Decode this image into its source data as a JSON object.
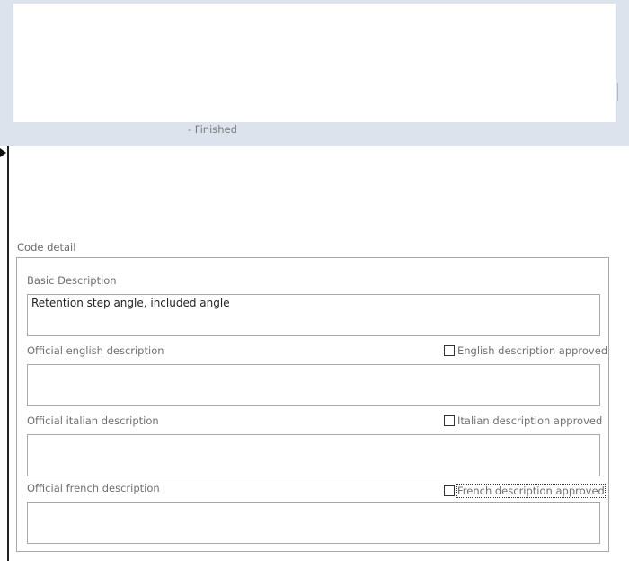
{
  "header": {
    "status_text": "- Finished"
  },
  "code_detail": {
    "group_label": "Code detail",
    "basic": {
      "label": "Basic Description",
      "value": "Retention step angle, included angle"
    },
    "english": {
      "label": "Official english description",
      "value": "",
      "approved_label": "English description approved",
      "approved": false
    },
    "italian": {
      "label": "Official italian description",
      "value": "",
      "approved_label": "Italian description approved",
      "approved": false
    },
    "french": {
      "label": "Official french description",
      "value": "",
      "approved_label": "French description approved",
      "approved": false
    }
  },
  "icons": {
    "record_selector": "current-record-arrow-icon"
  }
}
